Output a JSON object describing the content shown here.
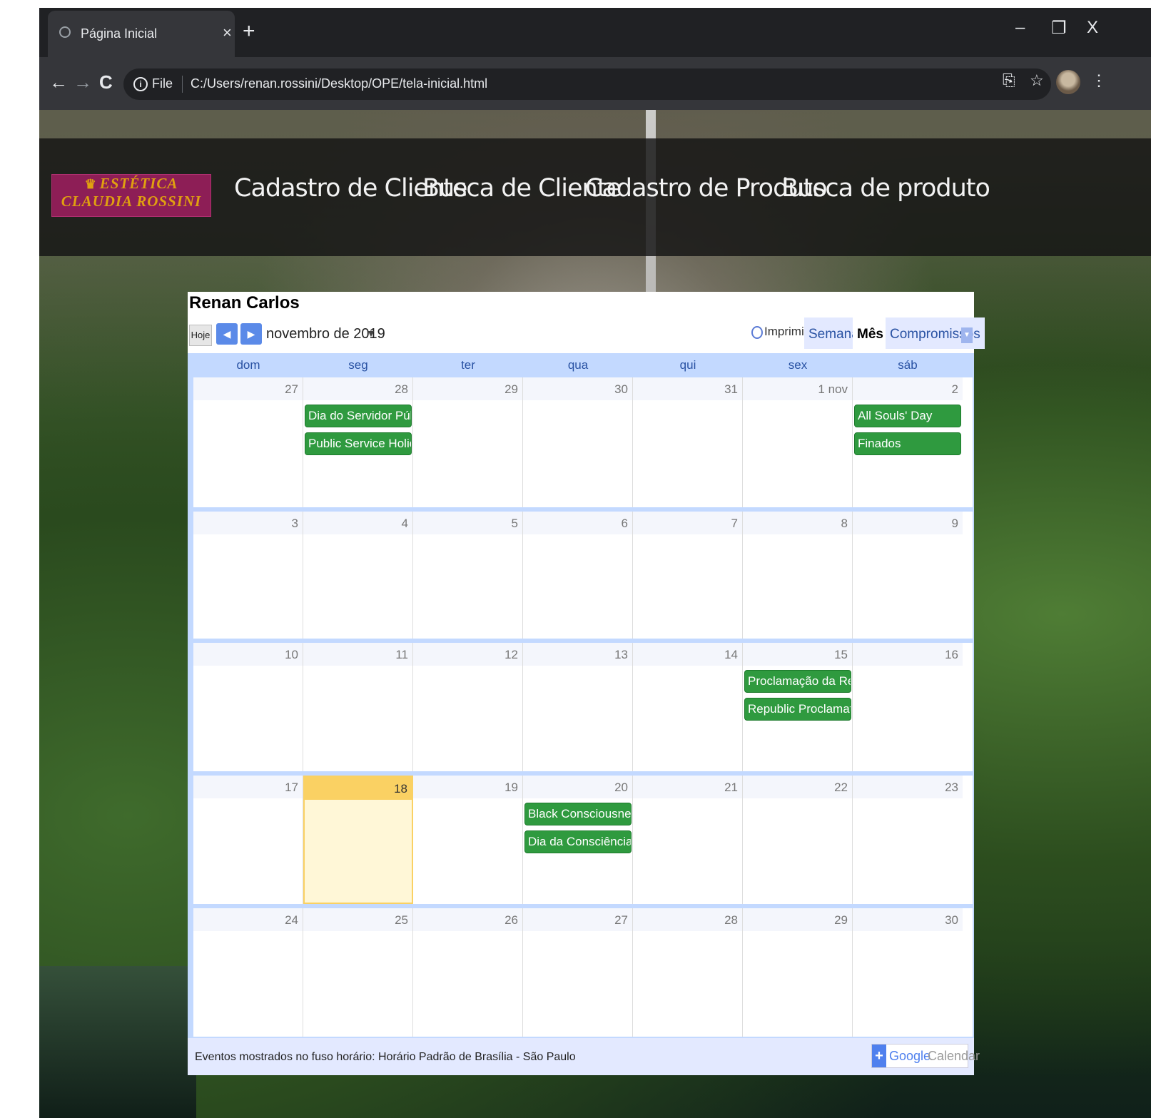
{
  "browser": {
    "tab_title": "Página Inicial",
    "tab_close": "×",
    "new_tab": "+",
    "window_controls": {
      "minimize": "–",
      "restore": "❐",
      "close": "X"
    },
    "nav": {
      "back": "←",
      "forward": "→",
      "reload": "C"
    },
    "omnibox": {
      "info": "i",
      "scheme_label": "File",
      "url": "C:/Users/renan.rossini/Desktop/OPE/tela-inicial.html"
    },
    "toolbar_icons": {
      "translate": "⎘",
      "star": "☆",
      "menu": "⋮"
    }
  },
  "site": {
    "logo": {
      "line1": "ESTÉTICA",
      "line2": "CLAUDIA ROSSINI",
      "crown": "♛"
    },
    "nav_links": [
      "Cadastro de Cliente",
      "Busca de Cliente",
      "Cadastro de Produto",
      "Busca de produto"
    ]
  },
  "calendar": {
    "owner": "Renan Carlos",
    "today_button": "Hoje",
    "prev": "◀",
    "next": "▶",
    "month_label": "novembro de 2019",
    "month_caret": "▼",
    "print_label": "Imprimir",
    "view_tabs": [
      "Semana",
      "Mês",
      "Compromissos"
    ],
    "active_view": "Mês",
    "view_dropdown": "▼",
    "weekdays": [
      "dom",
      "seg",
      "ter",
      "qua",
      "qui",
      "sex",
      "sáb"
    ],
    "weeks": [
      {
        "days": [
          {
            "label": "27",
            "events": []
          },
          {
            "label": "28",
            "events": [
              "Dia do Servidor Público",
              "Public Service Holiday"
            ]
          },
          {
            "label": "29",
            "events": []
          },
          {
            "label": "30",
            "events": []
          },
          {
            "label": "31",
            "events": []
          },
          {
            "label": "1 nov",
            "events": []
          },
          {
            "label": "2",
            "events": [
              "All Souls' Day",
              "Finados"
            ]
          }
        ]
      },
      {
        "days": [
          {
            "label": "3",
            "events": []
          },
          {
            "label": "4",
            "events": []
          },
          {
            "label": "5",
            "events": []
          },
          {
            "label": "6",
            "events": []
          },
          {
            "label": "7",
            "events": []
          },
          {
            "label": "8",
            "events": []
          },
          {
            "label": "9",
            "events": []
          }
        ]
      },
      {
        "days": [
          {
            "label": "10",
            "events": []
          },
          {
            "label": "11",
            "events": []
          },
          {
            "label": "12",
            "events": []
          },
          {
            "label": "13",
            "events": []
          },
          {
            "label": "14",
            "events": []
          },
          {
            "label": "15",
            "events": [
              "Proclamação da República",
              "Republic Proclamation Day"
            ]
          },
          {
            "label": "16",
            "events": []
          }
        ]
      },
      {
        "days": [
          {
            "label": "17",
            "events": []
          },
          {
            "label": "18",
            "events": [],
            "today": true
          },
          {
            "label": "19",
            "events": []
          },
          {
            "label": "20",
            "events": [
              "Black Consciousness Day",
              "Dia da Consciência Negra"
            ]
          },
          {
            "label": "21",
            "events": []
          },
          {
            "label": "22",
            "events": []
          },
          {
            "label": "23",
            "events": []
          }
        ]
      },
      {
        "days": [
          {
            "label": "24",
            "events": []
          },
          {
            "label": "25",
            "events": []
          },
          {
            "label": "26",
            "events": []
          },
          {
            "label": "27",
            "events": []
          },
          {
            "label": "28",
            "events": []
          },
          {
            "label": "29",
            "events": []
          },
          {
            "label": "30",
            "events": []
          }
        ]
      }
    ],
    "footer_text": "Eventos mostrados no fuso horário: Horário Padrão de Brasília - São Paulo",
    "badge": {
      "plus": "+",
      "google": "Google",
      "calendar": "Calendar"
    },
    "colors": {
      "event": "#2f9a3f",
      "today": "#fad163",
      "header_bg": "#c3d9ff"
    }
  }
}
